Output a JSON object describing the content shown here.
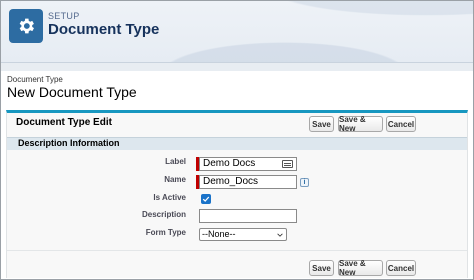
{
  "setup": {
    "label": "SETUP",
    "title": "Document Type",
    "icon": "gear-icon"
  },
  "page": {
    "subtitle": "Document Type",
    "title": "New Document Type"
  },
  "edit": {
    "title": "Document Type Edit",
    "buttons": {
      "save": "Save",
      "save_new": "Save & New",
      "cancel": "Cancel"
    }
  },
  "section": {
    "title": "Description Information"
  },
  "form": {
    "label": {
      "label": "Label",
      "value": "Demo Docs",
      "icon": "lookup-icon"
    },
    "name": {
      "label": "Name",
      "value": "Demo_Docs",
      "icon": "info-icon"
    },
    "is_active": {
      "label": "Is Active",
      "checked": true
    },
    "description": {
      "label": "Description",
      "value": ""
    },
    "form_type": {
      "label": "Form Type",
      "selected": "--None--"
    }
  },
  "colors": {
    "setup_icon_bg": "#2d6ca2",
    "accent_border": "#1797c0",
    "required": "#c00000",
    "checkbox": "#1a73c9",
    "section_bg": "#dde7ee"
  }
}
